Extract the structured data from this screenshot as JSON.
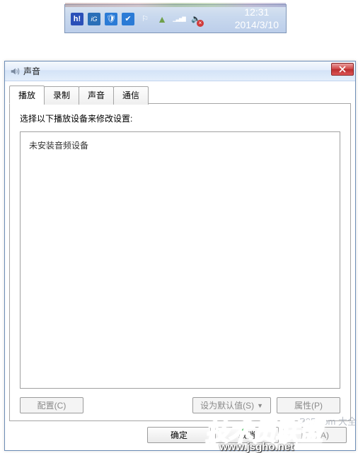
{
  "taskbar": {
    "icons": [
      {
        "name": "h-icon",
        "glyph": "h!"
      },
      {
        "name": "ig-icon",
        "glyph": "iG"
      },
      {
        "name": "shield-icon",
        "glyph": "🛡"
      },
      {
        "name": "check-icon",
        "glyph": "✔"
      },
      {
        "name": "flag-icon",
        "glyph": "⚐"
      },
      {
        "name": "up-arrow-icon",
        "glyph": "▲"
      },
      {
        "name": "signal-icon",
        "glyph": "▁▃▅▇"
      },
      {
        "name": "volume-muted-icon",
        "glyph": "🔈"
      }
    ],
    "clock": {
      "time": "12:31",
      "date": "2014/3/10"
    }
  },
  "dialog": {
    "title": "声音",
    "tabs": [
      {
        "label": "播放",
        "active": true
      },
      {
        "label": "录制",
        "active": false
      },
      {
        "label": "声音",
        "active": false
      },
      {
        "label": "通信",
        "active": false
      }
    ],
    "instruction": "选择以下播放设备来修改设置:",
    "device_list_message": "未安装音频设备",
    "buttons": {
      "configure": "配置(C)",
      "set_default": "设为默认值(S)",
      "properties": "属性(P)",
      "ok": "确定",
      "cancel": "取消",
      "apply": "应用(A)"
    }
  },
  "watermarks": {
    "logo": "技术员联盟",
    "url": "www.jsgho.net",
    "right_text": "P85.com 大全"
  }
}
